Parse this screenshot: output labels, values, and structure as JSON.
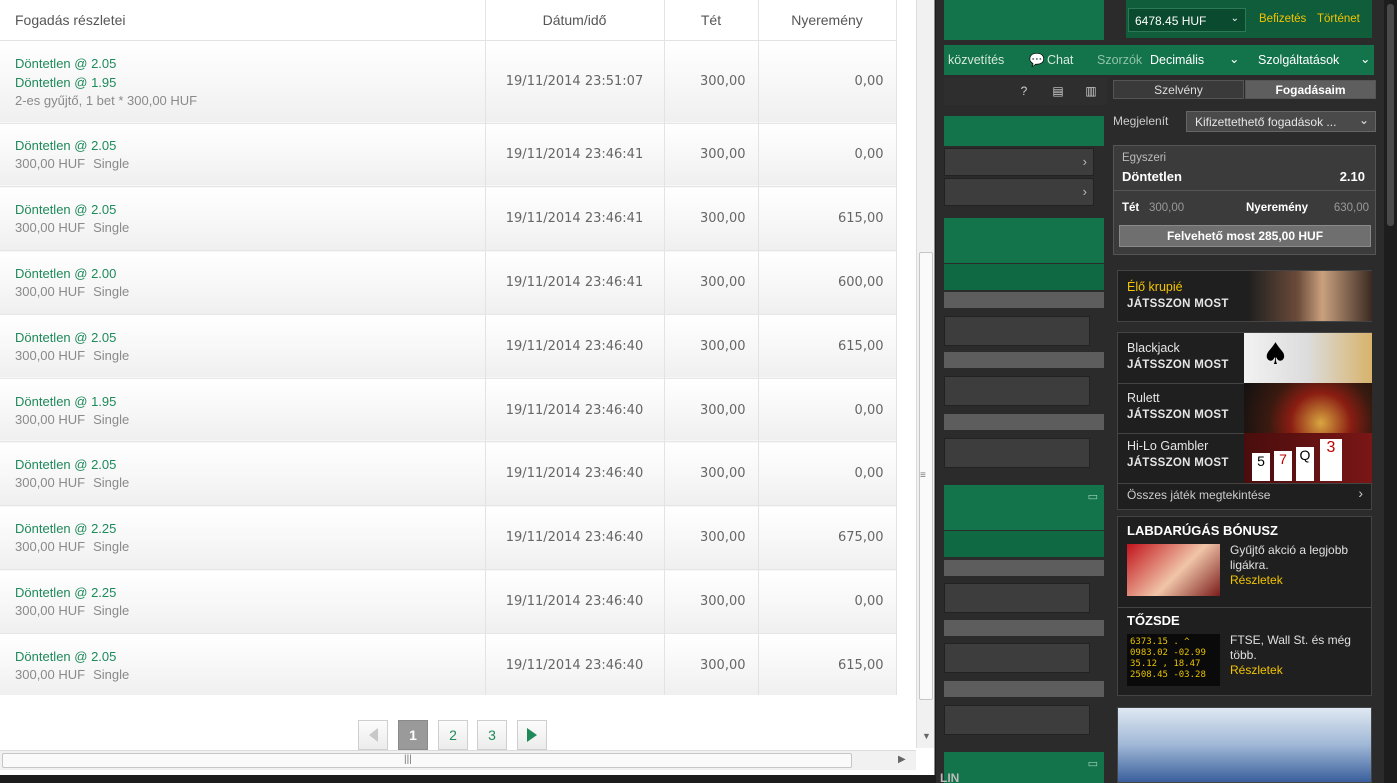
{
  "bets_table": {
    "headers": {
      "details": "Fogadás részletei",
      "datetime": "Dátum/idő",
      "stake": "Tét",
      "winnings": "Nyeremény"
    },
    "rows": [
      {
        "lines": [
          "Döntetlen @  2.05",
          "Döntetlen @  1.95"
        ],
        "sub": "2-es gyűjtő, 1  bet * 300,00 HUF",
        "type": "",
        "datetime": "19/11/2014 23:51:07",
        "stake": "300,00",
        "winnings": "0,00"
      },
      {
        "lines": [
          "Döntetlen @  2.05"
        ],
        "sub": "300,00 HUF",
        "type": "Single",
        "datetime": "19/11/2014 23:46:41",
        "stake": "300,00",
        "winnings": "0,00"
      },
      {
        "lines": [
          "Döntetlen @  2.05"
        ],
        "sub": "300,00 HUF",
        "type": "Single",
        "datetime": "19/11/2014 23:46:41",
        "stake": "300,00",
        "winnings": "615,00"
      },
      {
        "lines": [
          "Döntetlen @  2.00"
        ],
        "sub": "300,00 HUF",
        "type": "Single",
        "datetime": "19/11/2014 23:46:41",
        "stake": "300,00",
        "winnings": "600,00"
      },
      {
        "lines": [
          "Döntetlen @  2.05"
        ],
        "sub": "300,00 HUF",
        "type": "Single",
        "datetime": "19/11/2014 23:46:40",
        "stake": "300,00",
        "winnings": "615,00"
      },
      {
        "lines": [
          "Döntetlen @  1.95"
        ],
        "sub": "300,00 HUF",
        "type": "Single",
        "datetime": "19/11/2014 23:46:40",
        "stake": "300,00",
        "winnings": "0,00"
      },
      {
        "lines": [
          "Döntetlen @  2.05"
        ],
        "sub": "300,00 HUF",
        "type": "Single",
        "datetime": "19/11/2014 23:46:40",
        "stake": "300,00",
        "winnings": "0,00"
      },
      {
        "lines": [
          "Döntetlen @  2.25"
        ],
        "sub": "300,00 HUF",
        "type": "Single",
        "datetime": "19/11/2014 23:46:40",
        "stake": "300,00",
        "winnings": "675,00"
      },
      {
        "lines": [
          "Döntetlen @  2.25"
        ],
        "sub": "300,00 HUF",
        "type": "Single",
        "datetime": "19/11/2014 23:46:40",
        "stake": "300,00",
        "winnings": "0,00"
      },
      {
        "lines": [
          "Döntetlen @  2.05"
        ],
        "sub": "300,00 HUF",
        "type": "Single",
        "datetime": "19/11/2014 23:46:40",
        "stake": "300,00",
        "winnings": "615,00"
      }
    ]
  },
  "pagination": {
    "pages": [
      "1",
      "2",
      "3"
    ],
    "current": "1"
  },
  "site": {
    "balance": "6478.45 HUF",
    "links": {
      "deposit": "Befizetés",
      "history": "Történet"
    },
    "nav": {
      "broadcast": "közvetítés",
      "chat": "Chat",
      "odds_label": "Szorzók",
      "odds_value": "Decimális",
      "services": "Szolgáltatások"
    },
    "slip_tabs": {
      "slip": "Szelvény",
      "my_bets": "Fogadásaim"
    },
    "show_label": "Megjelenít",
    "show_value": "Kifizettethető fogadások ...",
    "slip": {
      "type": "Egyszeri",
      "selection": "Döntetlen",
      "odds": "2.10",
      "stake_label": "Tét",
      "stake_value": "300,00",
      "win_label": "Nyeremény",
      "win_value": "630,00",
      "cashout": "Felvehető most 285,00 HUF"
    },
    "promos": {
      "live_dealer": {
        "title": "Élő krupié",
        "cta": "JÁTSSZON MOST"
      },
      "blackjack": {
        "title": "Blackjack",
        "cta": "JÁTSSZON MOST"
      },
      "roulette": {
        "title": "Rulett",
        "cta": "JÁTSSZON MOST"
      },
      "hilo": {
        "title": "Hi-Lo Gambler",
        "cta": "JÁTSSZON MOST"
      },
      "all_games": "Összes játék megtekintése",
      "football_bonus": {
        "title": "LABDARÚGÁS BÓNUSZ",
        "text": "Gyűjtő akció a legjobb ligákra.",
        "link": "Részletek"
      },
      "stock": {
        "title": "TŐZSDE",
        "text": "FTSE, Wall St. és még több.",
        "link": "Részletek"
      }
    },
    "bottom_text": "LIN",
    "colors": {
      "brand_green": "#13734a",
      "accent_yellow": "#f3c400",
      "selection_green": "#1e8a5a"
    }
  }
}
